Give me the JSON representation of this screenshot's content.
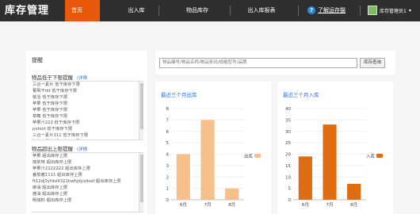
{
  "app": {
    "title": "库存管理"
  },
  "nav": {
    "home": "首页",
    "items": [
      "出入库",
      "物品库存",
      "出入库报表"
    ],
    "help": "了解运存猫",
    "user": "库存管理员1",
    "help_icon": "question-circle-icon",
    "avatar_icon": "user-avatar-icon",
    "caret": "▾"
  },
  "reminder": {
    "title": "提醒",
    "low_stock": {
      "title": "物品低于下限提醒",
      "link": "(详情",
      "items": [
        "三合一素片 低于库存下限",
        "葡萄干dd 低于库存下限",
        "桃活 低于库存下限",
        "苹果 低于库存下限",
        "苹果 低于库存下限",
        "草莓 低于库存下限",
        "苹果汁222 低于库存下限",
        "pxtest 低于库存下限",
        "三合一素片111 低于库存下限",
        "三合一素片 低于库存下限"
      ]
    },
    "high_stock": {
      "title": "物品超出上限提醒",
      "link": "(详情",
      "items": [
        "苹果 超出库存上限",
        "嗅依味 超出库存上限",
        "苹果汁2222222 超出库存上限",
        "番茄酱1111 超出库存上限",
        "ft12dj3yfdsl4321hwhjdyxdsaf 超出库存上限",
        "麻油 超出库存上限",
        "酱油 超出库存上限",
        "明城料 超出库存上限"
      ]
    }
  },
  "search": {
    "placeholder": "物品编号/物品名称/物品条码/规格型号/品牌",
    "button": "库存查询"
  },
  "chart_data": [
    {
      "type": "bar",
      "title": "最近三个月出库",
      "categories": [
        "6月",
        "7月",
        "8月"
      ],
      "series": [
        {
          "name": "出库",
          "values": [
            4,
            7,
            1
          ],
          "color": "#f7c08b"
        }
      ],
      "ylim": [
        0,
        8
      ],
      "yticks": [
        0,
        1,
        2,
        3,
        4,
        5,
        6,
        7,
        8
      ],
      "grid": true,
      "legend": "right"
    },
    {
      "type": "bar",
      "title": "最近三个月入库",
      "categories": [
        "6月",
        "7月",
        "8月"
      ],
      "series": [
        {
          "name": "入库",
          "values": [
            19,
            33,
            7
          ],
          "color": "#e06c12"
        }
      ],
      "ylim": [
        0,
        40
      ],
      "yticks": [
        0,
        5,
        10,
        15,
        20,
        25,
        30,
        35,
        40
      ],
      "grid": true,
      "legend": "right"
    }
  ]
}
